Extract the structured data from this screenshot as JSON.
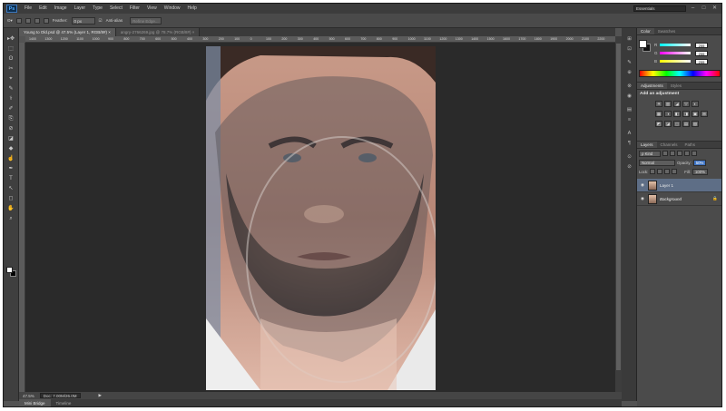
{
  "app": {
    "logo": "Ps"
  },
  "menu": [
    "File",
    "Edit",
    "Image",
    "Layer",
    "Type",
    "Select",
    "Filter",
    "View",
    "Window",
    "Help"
  ],
  "workspace": "Essentials",
  "window_controls": [
    "–",
    "□",
    "✕"
  ],
  "options_bar": {
    "feather_label": "Feather:",
    "feather_value": "0 px",
    "antialias_label": "Anti-alias",
    "refine_edge_label": "Refine Edge..."
  },
  "document_tabs": [
    {
      "label": "Young to Old.psd @ 47.5% (Layer 1, RGB/8#) ×",
      "active": true
    },
    {
      "label": "angry-2766269.jpg @ 78.7% (RGB/8#) ×",
      "active": false
    }
  ],
  "ruler_ticks": [
    "1400",
    "1300",
    "1200",
    "1100",
    "1000",
    "900",
    "800",
    "700",
    "600",
    "500",
    "400",
    "300",
    "200",
    "100",
    "0",
    "100",
    "200",
    "300",
    "400",
    "500",
    "600",
    "700",
    "800",
    "900",
    "1000",
    "1100",
    "1200",
    "1300",
    "1400",
    "1500",
    "1600",
    "1700",
    "1800",
    "1900",
    "2000",
    "2100",
    "2200"
  ],
  "status": {
    "zoom": "47.5%",
    "doc": "Doc: 7.00M/26.0M"
  },
  "bottom_tabs": [
    "Mini Bridge",
    "Timeline"
  ],
  "panels": {
    "color_tabs": [
      "Color",
      "Swatches"
    ],
    "color": {
      "r_label": "R",
      "r_value": "255",
      "g_label": "G",
      "g_value": "255",
      "b_label": "B",
      "b_value": "255"
    },
    "adjustment_tabs": [
      "Adjustments",
      "Styles"
    ],
    "adjustment_title": "Add an adjustment",
    "adjustment_icons_row1": [
      "☀",
      "▥",
      "◢",
      "▽",
      "◐"
    ],
    "adjustment_icons_row2": [
      "▦",
      "◑",
      "◧",
      "◨",
      "▣",
      "⊞"
    ],
    "adjustment_icons_row3": [
      "◩",
      "◪",
      "◫",
      "▤",
      "▧"
    ],
    "layers_tabs": [
      "Layers",
      "Channels",
      "Paths"
    ],
    "kind_label": "ρ Kind",
    "blend_mode": "Normal",
    "opacity_label": "Opacity:",
    "opacity_value": "50%",
    "lock_label": "Lock:",
    "fill_label": "Fill:",
    "fill_value": "100%",
    "layers": [
      {
        "name": "Layer 1",
        "selected": true,
        "locked": false
      },
      {
        "name": "Background",
        "selected": false,
        "locked": true
      }
    ]
  },
  "tools": [
    "▸✥",
    "⬚",
    "ʘ",
    "✂",
    "⌖",
    "✎",
    "⚕",
    "✐",
    "⎘",
    "⊘",
    "◪",
    "◆",
    "☝",
    "✒",
    "T",
    "↖",
    "◻",
    "✋",
    "⌕"
  ],
  "panel_icons": [
    "⊞",
    "⊡",
    "✎",
    "⊕",
    "⊗",
    "◉",
    "▤",
    "≡",
    "A",
    "¶",
    "⊙",
    "⊘"
  ]
}
